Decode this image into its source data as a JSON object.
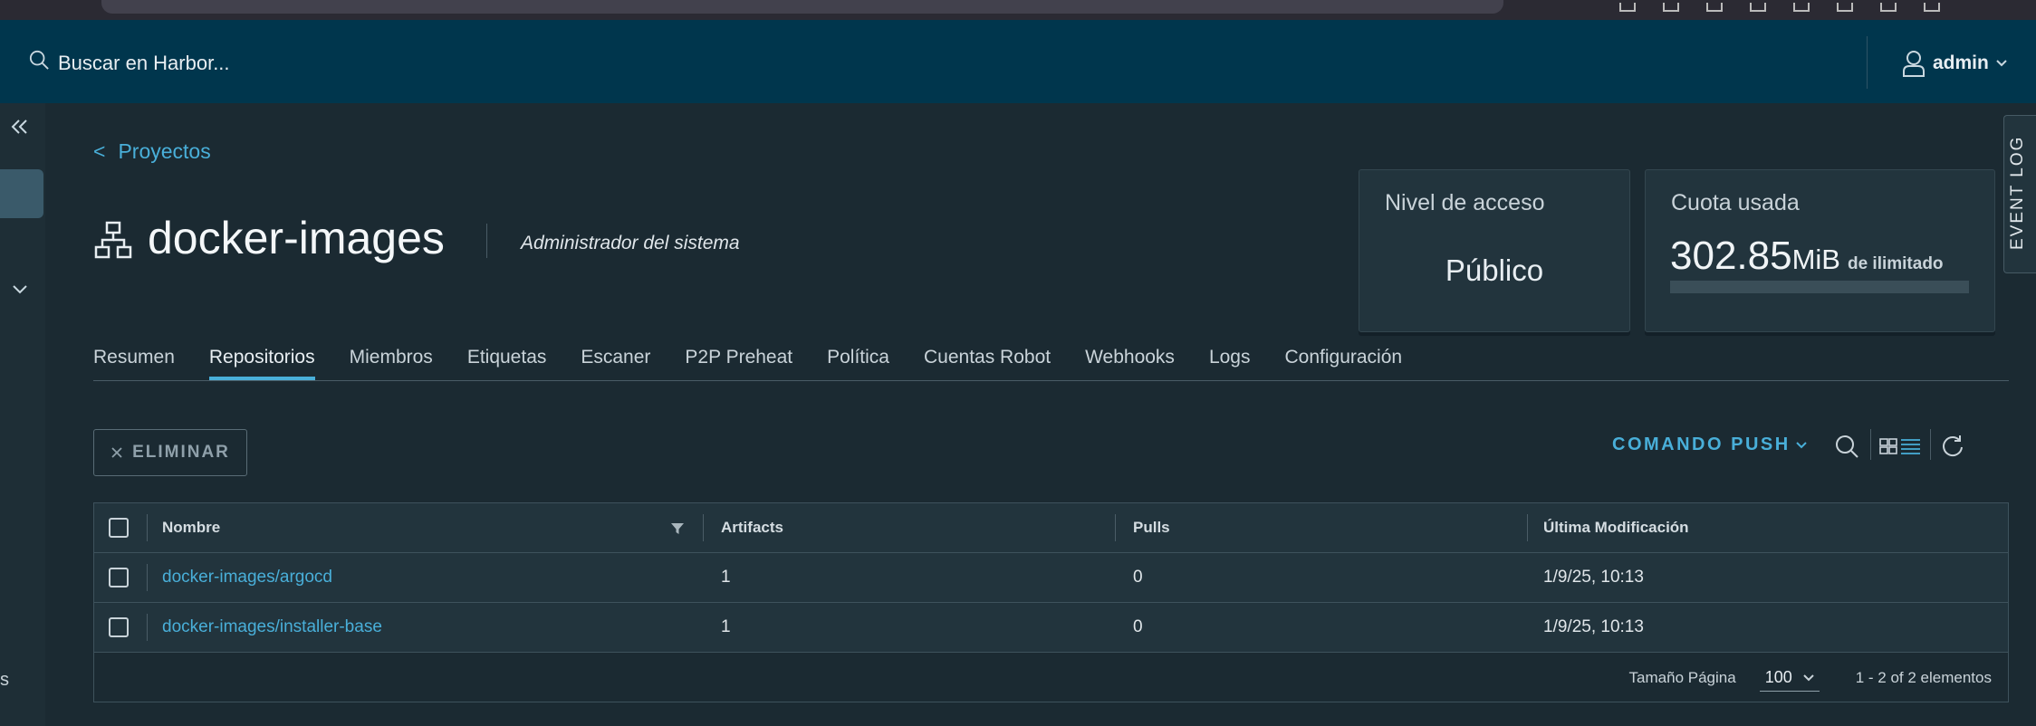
{
  "header": {
    "search_placeholder": "Buscar en Harbor...",
    "user": "admin"
  },
  "sidebar": {
    "truncated_label": "s"
  },
  "project": {
    "back_label": "Proyectos",
    "name": "docker-images",
    "role": "Administrador del sistema"
  },
  "cards": {
    "access_label": "Nivel de acceso",
    "access_value": "Público",
    "quota_label": "Cuota usada",
    "quota_amount": "302.85",
    "quota_unit": "MiB",
    "quota_of": "de ilimitado",
    "quota_fraction": 0
  },
  "event_log": "EVENT LOG",
  "tabs": [
    {
      "label": "Resumen",
      "active": false
    },
    {
      "label": "Repositorios",
      "active": true
    },
    {
      "label": "Miembros",
      "active": false
    },
    {
      "label": "Etiquetas",
      "active": false
    },
    {
      "label": "Escaner",
      "active": false
    },
    {
      "label": "P2P Preheat",
      "active": false
    },
    {
      "label": "Política",
      "active": false
    },
    {
      "label": "Cuentas Robot",
      "active": false
    },
    {
      "label": "Webhooks",
      "active": false
    },
    {
      "label": "Logs",
      "active": false
    },
    {
      "label": "Configuración",
      "active": false
    }
  ],
  "toolbar": {
    "delete_label": "ELIMINAR",
    "push_label": "COMANDO PUSH"
  },
  "table": {
    "columns": [
      "Nombre",
      "Artifacts",
      "Pulls",
      "Última Modificación"
    ],
    "rows": [
      {
        "name": "docker-images/argocd",
        "artifacts": "1",
        "pulls": "0",
        "modified": "1/9/25, 10:13"
      },
      {
        "name": "docker-images/installer-base",
        "artifacts": "1",
        "pulls": "0",
        "modified": "1/9/25, 10:13"
      }
    ],
    "page_size_label": "Tamaño Página",
    "page_size": "100",
    "total": "1 - 2 of 2 elementos"
  },
  "colors": {
    "accent": "#49afd9",
    "header_bg": "#00364d",
    "page_bg": "#1b2a32"
  }
}
